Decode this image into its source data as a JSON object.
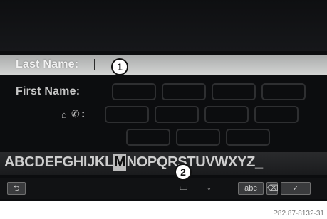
{
  "form": {
    "last_name_label": "Last Name:",
    "first_name_label": "First Name:",
    "phone_label": ":"
  },
  "keyboard": {
    "letters_before": "ABCDEFGHIJKL",
    "selected_letter": "M",
    "letters_after": "NOPQRSTUVWXYZ_",
    "abc_label": "abc"
  },
  "callouts": {
    "one": "1",
    "two": "2"
  },
  "caption": "P82.87-8132-31"
}
